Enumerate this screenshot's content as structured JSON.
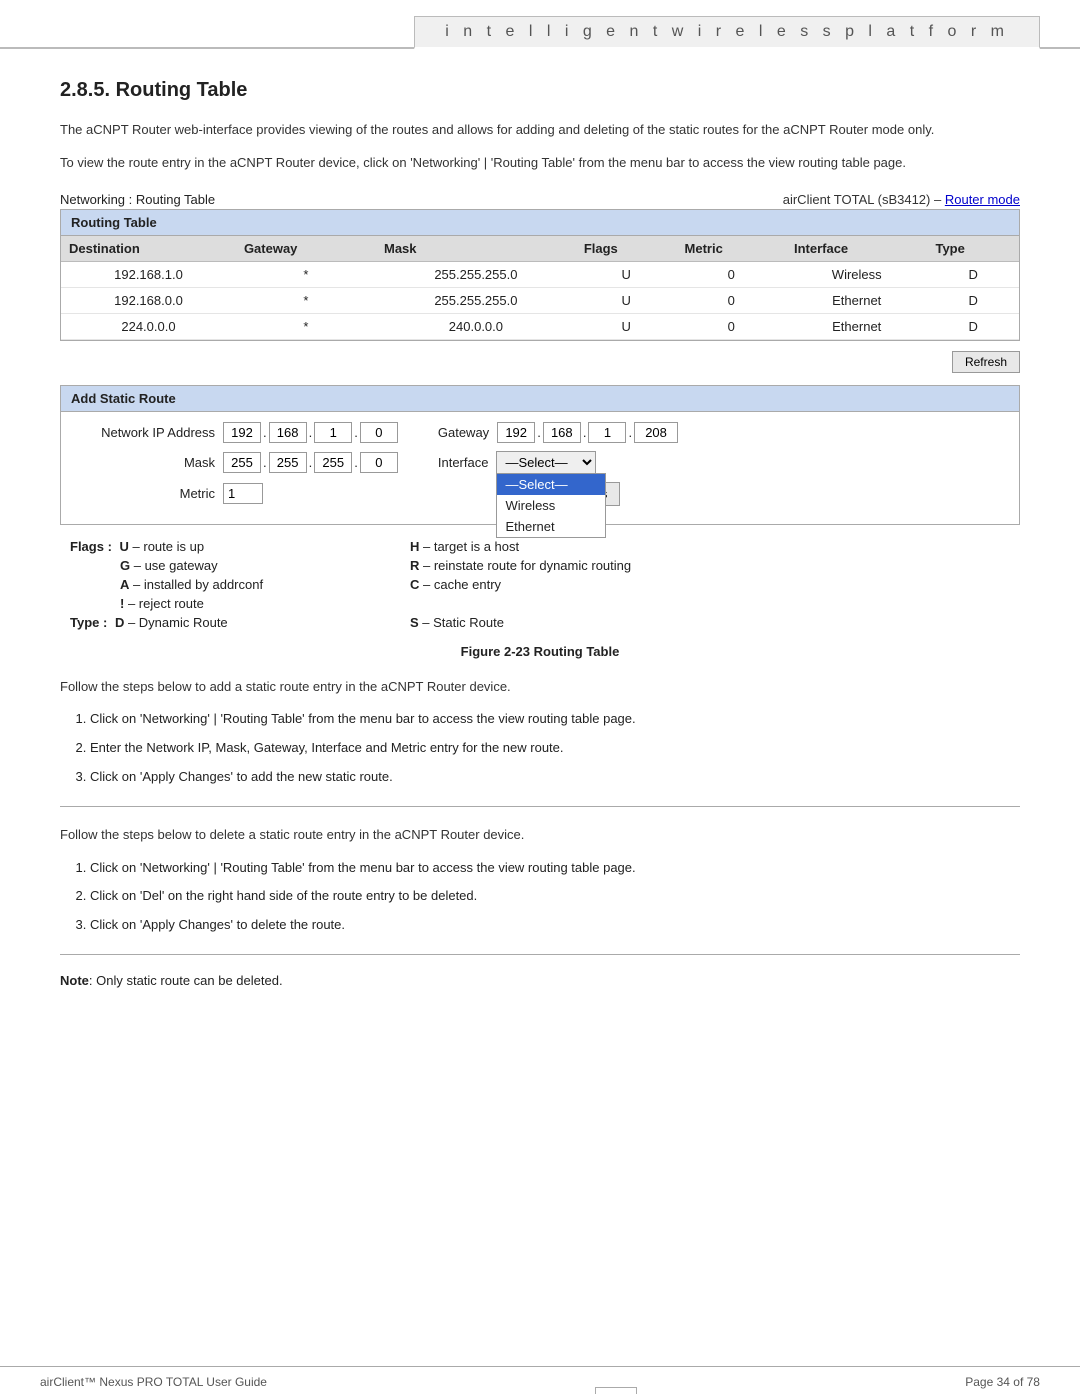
{
  "header": {
    "title": "i n t e l l i g e n t   w i r e l e s s   p l a t f o r m"
  },
  "section_title": "2.8.5.  Routing Table",
  "intro_para1": "The aCNPT Router web-interface provides viewing of the routes and allows for adding and deleting of the static routes for the aCNPT Router mode only.",
  "intro_para2": "To view the route entry in the aCNPT Router device, click on 'Networking' | 'Routing Table' from the menu bar to access the view routing table page.",
  "networking_label": "Networking : Routing Table",
  "air_client_label": "airClient TOTAL (sB3412) –",
  "router_mode_link": "Router mode",
  "routing_table": {
    "box_title": "Routing Table",
    "columns": [
      "Destination",
      "Gateway",
      "Mask",
      "Flags",
      "Metric",
      "Interface",
      "Type"
    ],
    "rows": [
      {
        "destination": "192.168.1.0",
        "gateway": "*",
        "mask": "255.255.255.0",
        "flags": "U",
        "metric": "0",
        "interface": "Wireless",
        "type": "D"
      },
      {
        "destination": "192.168.0.0",
        "gateway": "*",
        "mask": "255.255.255.0",
        "flags": "U",
        "metric": "0",
        "interface": "Ethernet",
        "type": "D"
      },
      {
        "destination": "224.0.0.0",
        "gateway": "*",
        "mask": "240.0.0.0",
        "flags": "U",
        "metric": "0",
        "interface": "Ethernet",
        "type": "D"
      }
    ]
  },
  "refresh_btn": "Refresh",
  "add_static_route": {
    "box_title": "Add Static Route",
    "network_ip_label": "Network IP Address",
    "network_ip": [
      "192",
      "168",
      "1",
      "0"
    ],
    "gateway_label": "Gateway",
    "gateway_ip": [
      "192",
      "168",
      "1",
      "208"
    ],
    "mask_label": "Mask",
    "mask_ip": [
      "255",
      "255",
      "255",
      "0"
    ],
    "interface_label": "Interface",
    "interface_select": "—Select—",
    "metric_label": "Metric",
    "metric_value": "1",
    "apply_btn": "Apply Changes",
    "dropdown_options": [
      "—Select—",
      "Wireless",
      "Ethernet"
    ]
  },
  "flags": {
    "title": "Flags :",
    "left_items": [
      {
        "key": "U",
        "desc": "– route is up"
      },
      {
        "key": "G",
        "desc": "– use gateway"
      },
      {
        "key": "A",
        "desc": "– installed by addrconf"
      },
      {
        "key": "!",
        "desc": "– reject route"
      }
    ],
    "right_items": [
      {
        "key": "H",
        "desc": "– target is a host"
      },
      {
        "key": "R",
        "desc": "– reinstate route for dynamic routing"
      },
      {
        "key": "C",
        "desc": "– cache entry"
      }
    ]
  },
  "type_flags": {
    "title": "Type :",
    "left_items": [
      {
        "key": "D",
        "desc": "– Dynamic Route"
      }
    ],
    "right_items": [
      {
        "key": "S",
        "desc": "– Static Route"
      }
    ]
  },
  "figure_caption": "Figure 2-23 Routing Table",
  "add_steps_intro": "Follow the steps below to add a static route entry in the aCNPT Router device.",
  "add_steps": [
    "Click on 'Networking' | 'Routing Table' from the menu bar to access the view routing table page.",
    "Enter the Network IP, Mask, Gateway, Interface and Metric entry for the new route.",
    "Click on 'Apply Changes' to add the new static route."
  ],
  "delete_steps_intro": "Follow the steps below to delete a static route entry in the aCNPT Router device.",
  "delete_steps": [
    "Click on 'Networking' | 'Routing Table' from the menu bar to access the view routing table page.",
    "Click on 'Del' on the right hand side of the route entry to be deleted.",
    "Click on 'Apply Changes' to delete the route."
  ],
  "note_label": "Note",
  "note_text": "Only static route can be deleted.",
  "footer_left": "airClient™ Nexus PRO TOTAL User Guide",
  "footer_right": "Page 34 of 78"
}
